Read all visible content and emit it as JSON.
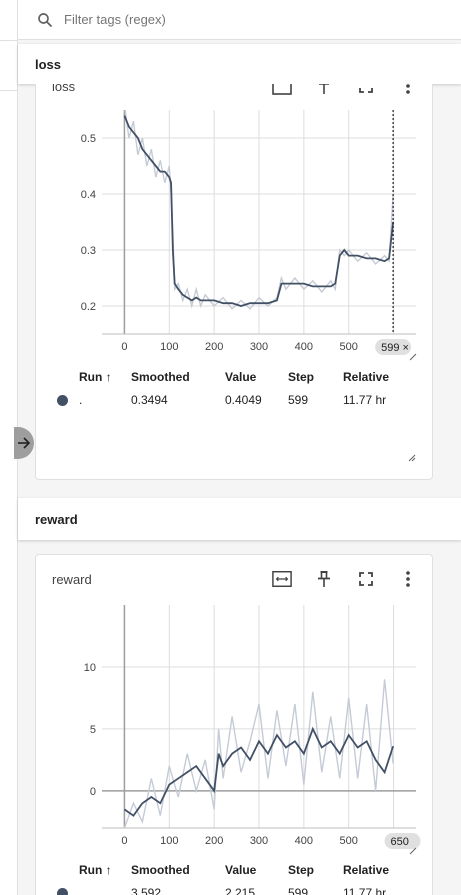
{
  "filter": {
    "placeholder": "Filter tags (regex)"
  },
  "groups": [
    {
      "name": "loss"
    },
    {
      "name": "reward"
    }
  ],
  "cards": [
    {
      "title": "loss",
      "columns": [
        "Run ↑",
        "Smoothed",
        "Value",
        "Step",
        "Relative"
      ],
      "row": {
        "run": ".",
        "smoothed": "0.3494",
        "value": "0.4049",
        "step": "599",
        "relative": "11.77 hr"
      },
      "step_chip": "599 ×"
    },
    {
      "title": "reward",
      "columns": [
        "Run ↑",
        "Smoothed",
        "Value",
        "Step",
        "Relative"
      ],
      "row": {
        "run": "",
        "smoothed": "3.592",
        "value": "2.215",
        "step": "599",
        "relative": "11.77 hr"
      },
      "step_chip": "650"
    }
  ],
  "colors": {
    "series": "#425066",
    "series_raw": "#c5cbd6",
    "grid": "#dddddd",
    "axis": "#9e9e9e"
  },
  "chart_data": [
    {
      "type": "line",
      "title": "loss",
      "xlabel": "",
      "ylabel": "",
      "xlim": [
        -50,
        650
      ],
      "ylim": [
        0.15,
        0.55
      ],
      "xticks": [
        0,
        100,
        200,
        300,
        400,
        500,
        600
      ],
      "yticks": [
        0.2,
        0.3,
        0.4,
        0.5
      ],
      "cursor_x": 599,
      "grid": true,
      "series": [
        {
          "x": [
            0,
            10,
            20,
            30,
            40,
            50,
            60,
            70,
            80,
            90,
            100,
            104,
            108,
            112,
            120,
            130,
            140,
            150,
            160,
            170,
            180,
            200,
            220,
            240,
            260,
            280,
            300,
            320,
            340,
            350,
            360,
            380,
            400,
            420,
            440,
            460,
            470,
            480,
            490,
            500,
            520,
            540,
            560,
            580,
            590,
            599
          ],
          "smoothed": [
            0.54,
            0.52,
            0.51,
            0.5,
            0.48,
            0.47,
            0.46,
            0.45,
            0.44,
            0.44,
            0.43,
            0.42,
            0.3,
            0.24,
            0.23,
            0.22,
            0.215,
            0.21,
            0.215,
            0.21,
            0.21,
            0.21,
            0.205,
            0.205,
            0.2,
            0.205,
            0.205,
            0.205,
            0.21,
            0.24,
            0.24,
            0.24,
            0.24,
            0.235,
            0.235,
            0.235,
            0.24,
            0.29,
            0.3,
            0.29,
            0.29,
            0.285,
            0.285,
            0.28,
            0.285,
            0.35
          ],
          "raw": [
            0.56,
            0.5,
            0.53,
            0.47,
            0.5,
            0.45,
            0.48,
            0.43,
            0.46,
            0.42,
            0.45,
            0.4,
            0.33,
            0.23,
            0.24,
            0.21,
            0.23,
            0.2,
            0.23,
            0.2,
            0.22,
            0.2,
            0.215,
            0.195,
            0.21,
            0.195,
            0.215,
            0.2,
            0.215,
            0.25,
            0.23,
            0.25,
            0.23,
            0.245,
            0.225,
            0.245,
            0.23,
            0.3,
            0.29,
            0.3,
            0.28,
            0.295,
            0.275,
            0.29,
            0.28,
            0.4
          ]
        }
      ]
    },
    {
      "type": "line",
      "title": "reward",
      "xlabel": "",
      "ylabel": "",
      "xlim": [
        -50,
        650
      ],
      "ylim": [
        -3,
        15
      ],
      "xticks": [
        0,
        100,
        200,
        300,
        400,
        500,
        600
      ],
      "yticks": [
        0,
        5,
        10
      ],
      "grid": true,
      "series": [
        {
          "x": [
            0,
            20,
            40,
            60,
            80,
            100,
            120,
            140,
            160,
            180,
            200,
            210,
            220,
            240,
            260,
            280,
            300,
            320,
            340,
            360,
            380,
            400,
            420,
            440,
            460,
            480,
            500,
            520,
            540,
            560,
            580,
            599
          ],
          "smoothed": [
            -1.5,
            -2,
            -1,
            -0.5,
            -1,
            0.5,
            1,
            1.5,
            2,
            1,
            0,
            3,
            2,
            3,
            3.5,
            2.5,
            4,
            3,
            4.5,
            3.5,
            4,
            3,
            5,
            3.5,
            4,
            3,
            4.5,
            3.5,
            4,
            2.5,
            1.5,
            3.6
          ],
          "raw": [
            -3,
            -1,
            -2.5,
            1,
            -2,
            2,
            -0.5,
            3,
            0,
            2.5,
            -1.5,
            5,
            1,
            6,
            1.5,
            4,
            7,
            1,
            6.5,
            2,
            7,
            0.5,
            8,
            1.5,
            6,
            1,
            7.5,
            1,
            7,
            0,
            9,
            2.2
          ]
        }
      ]
    }
  ]
}
